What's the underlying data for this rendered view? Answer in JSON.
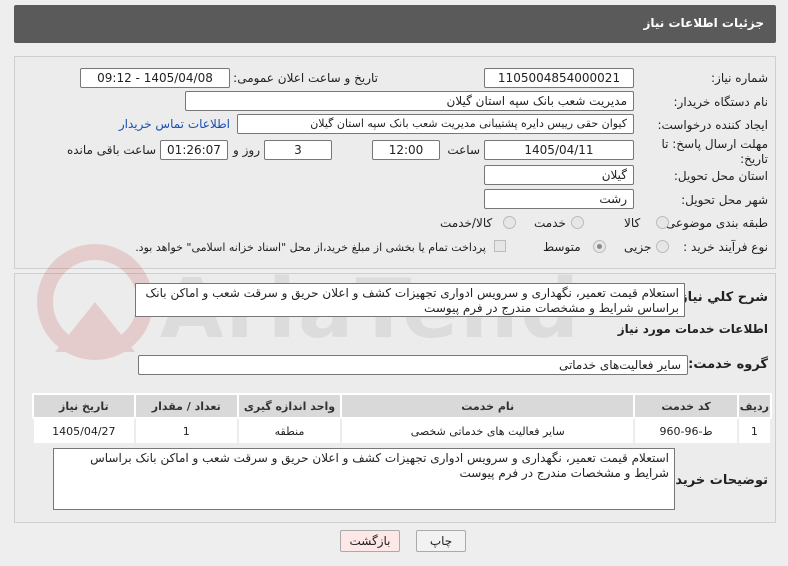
{
  "header": {
    "title": "جزئیات اطلاعات نیاز"
  },
  "form": {
    "need_number_label": "شماره نیاز:",
    "need_number": "1105004854000021",
    "announce_label": "تاریخ و ساعت اعلان عمومی:",
    "announce_value": "1405/04/08 - 09:12",
    "buyer_org_label": "نام دستگاه خریدار:",
    "buyer_org": "مدیریت شعب بانک سپه استان گیلان",
    "creator_label": "ایجاد کننده درخواست:",
    "creator": "کیوان حقی رییس دایره پشتیبانی  مدیریت شعب بانک سپه استان گیلان",
    "contact_link": "اطلاعات تماس خریدار",
    "deadline_label": "مهلت ارسال پاسخ: تا تاریخ:",
    "deadline_date": "1405/04/11",
    "time_label": "ساعت",
    "deadline_time": "12:00",
    "days_value": "3",
    "days_label": "روز و",
    "remaining_time": "01:26:07",
    "remaining_label": "ساعت باقی مانده",
    "province_label": "استان محل تحویل:",
    "province": "گیلان",
    "city_label": "شهر محل تحویل:",
    "city": "رشت",
    "category_label": "طبقه بندی موضوعی:",
    "category_options": [
      "کالا",
      "خدمت",
      "کالا/خدمت"
    ],
    "category_selected": "خدمت",
    "purchase_type_label": "نوع فرآیند خرید :",
    "purchase_options": [
      "جزیی",
      "متوسط"
    ],
    "purchase_selected": "متوسط",
    "payment_note": "پرداخت تمام یا بخشی از مبلغ خرید،از محل \"اسناد خزانه اسلامی\" خواهد بود."
  },
  "summary": {
    "label": "شرح کلي نياز:",
    "text": "استعلام قیمت تعمیر، نگهداری و سرویس ادواری تجهیزات کشف و اعلان حریق و سرقت شعب و اماکن بانک براساس شرایط و مشخصات مندرج در فرم پیوست"
  },
  "services": {
    "section_title": "اطلاعات خدمات مورد نياز",
    "group_label": "گروه خدمت:",
    "group_value": "سایر فعالیت‌های خدماتی",
    "columns": [
      "ردیف",
      "کد خدمت",
      "نام خدمت",
      "واحد اندازه گیری",
      "تعداد / مقدار",
      "تاریخ نیاز"
    ],
    "rows": [
      [
        "1",
        "ط-96-960",
        "سایر فعالیت های خدماتی شخصی",
        "منطقه",
        "1",
        "1405/04/27"
      ]
    ]
  },
  "buyer_notes": {
    "label": "توضیحات خریدار:",
    "text": "استعلام قیمت تعمیر، نگهداری و سرویس ادواری تجهیزات کشف و اعلان حریق و سرقت شعب و اماکن بانک براساس شرایط و مشخصات مندرج در فرم پیوست"
  },
  "buttons": {
    "print": "چاپ",
    "back": "بازگشت"
  },
  "watermark": {
    "brand": "AriaTender.net"
  },
  "colors": {
    "header_bg": "#5a5a5a",
    "link": "#1a4fb5",
    "back_button_bg": "#fde7e7",
    "print_button_bg": "#f2f2f2"
  }
}
